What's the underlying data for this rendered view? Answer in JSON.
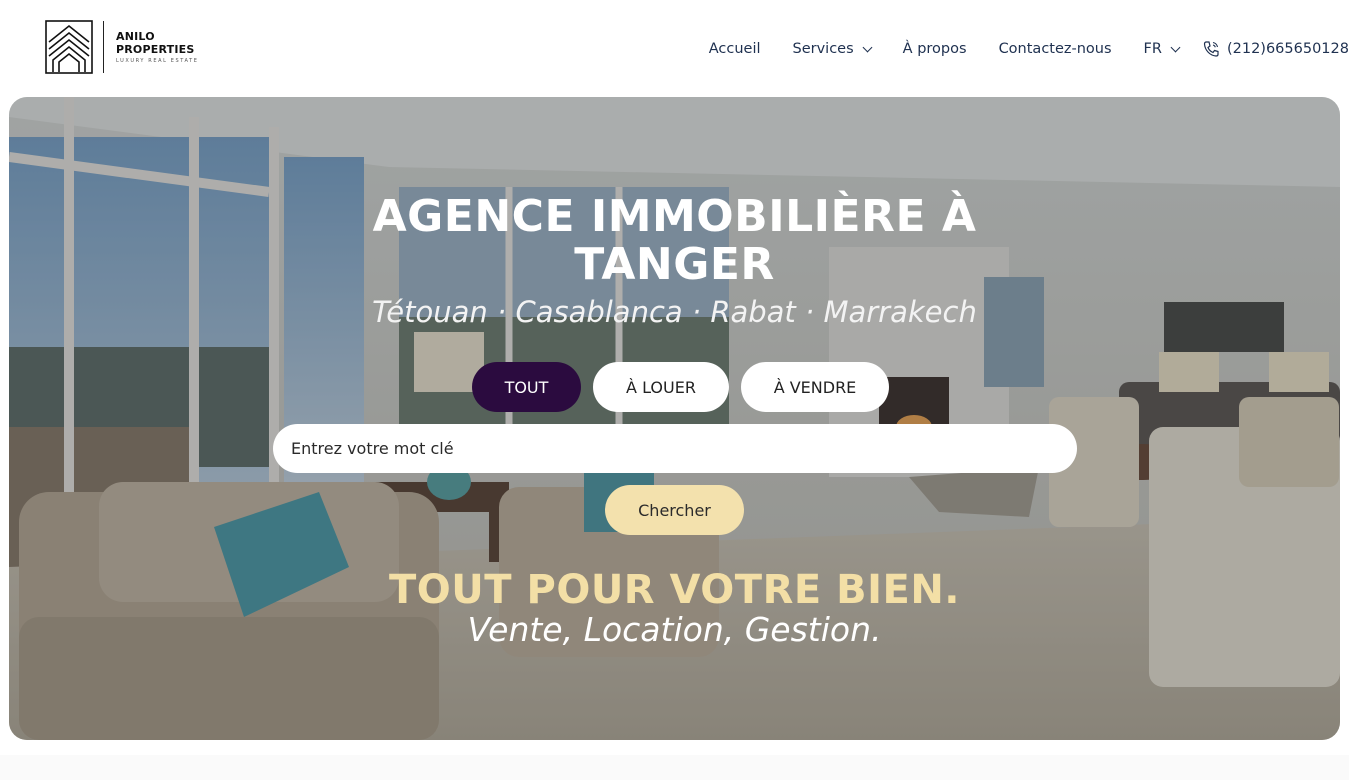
{
  "brand": {
    "name_line1": "ANILO",
    "name_line2": "PROPERTIES",
    "tagline": "LUXURY REAL ESTATE"
  },
  "nav": {
    "items": [
      {
        "label": "Accueil",
        "has_dropdown": false
      },
      {
        "label": "Services",
        "has_dropdown": true
      },
      {
        "label": "À propos",
        "has_dropdown": false
      },
      {
        "label": "Contactez-nous",
        "has_dropdown": false
      },
      {
        "label": "FR",
        "has_dropdown": true
      }
    ],
    "phone": "(212)665650128",
    "phone_icon": "phone-icon"
  },
  "hero": {
    "title_line1": "AGENCE IMMOBILIÈRE À",
    "title_line2": "TANGER",
    "cities": "Tétouan · Casablanca · Rabat · Marrakech",
    "tabs": [
      {
        "label": "TOUT",
        "active": true
      },
      {
        "label": "À LOUER",
        "active": false
      },
      {
        "label": "À VENDRE",
        "active": false
      }
    ],
    "search": {
      "placeholder": "Entrez votre mot clé",
      "value": ""
    },
    "search_button": "Chercher",
    "tagline": "TOUT POUR VOTRE BIEN.",
    "tagline_sub": "Vente, Location, Gestion."
  },
  "colors": {
    "nav_text": "#1f3150",
    "tab_active_bg": "#2b0b3f",
    "search_button_bg": "#f3e1ad",
    "tagline_color": "#f3dfa6"
  }
}
